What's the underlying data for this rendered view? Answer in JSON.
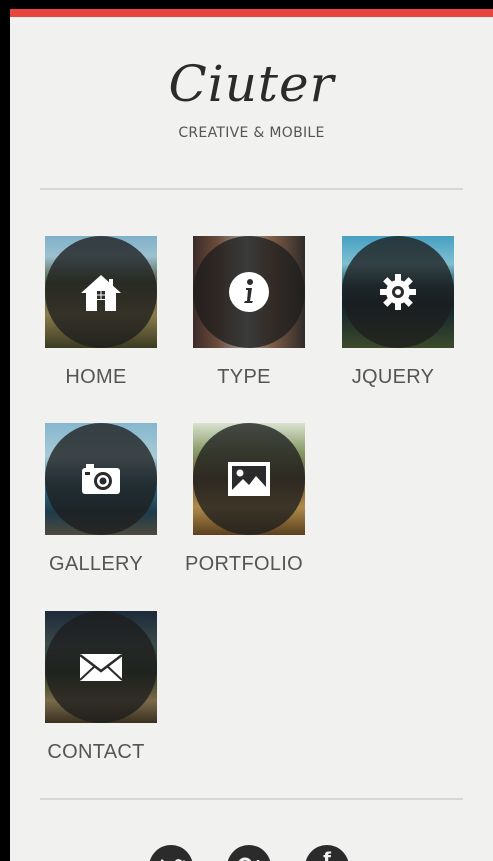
{
  "header": {
    "logo_text": "Ciuter",
    "tagline": "CREATIVE & MOBILE"
  },
  "menu": {
    "items": [
      {
        "label": "HOME",
        "icon": "home-icon"
      },
      {
        "label": "TYPE",
        "icon": "info-icon"
      },
      {
        "label": "JQUERY",
        "icon": "gear-icon"
      },
      {
        "label": "GALLERY",
        "icon": "camera-icon"
      },
      {
        "label": "PORTFOLIO",
        "icon": "image-icon"
      },
      {
        "label": "CONTACT",
        "icon": "envelope-icon"
      }
    ]
  },
  "social": {
    "items": [
      {
        "icon": "twitter-icon"
      },
      {
        "icon": "google-plus-icon"
      },
      {
        "icon": "facebook-icon",
        "glyph": "f"
      }
    ]
  },
  "colors": {
    "accent": "#e8453c",
    "panel_background": "#f1f1f0",
    "text": "#555555",
    "overlay": "#1e1e1e"
  }
}
